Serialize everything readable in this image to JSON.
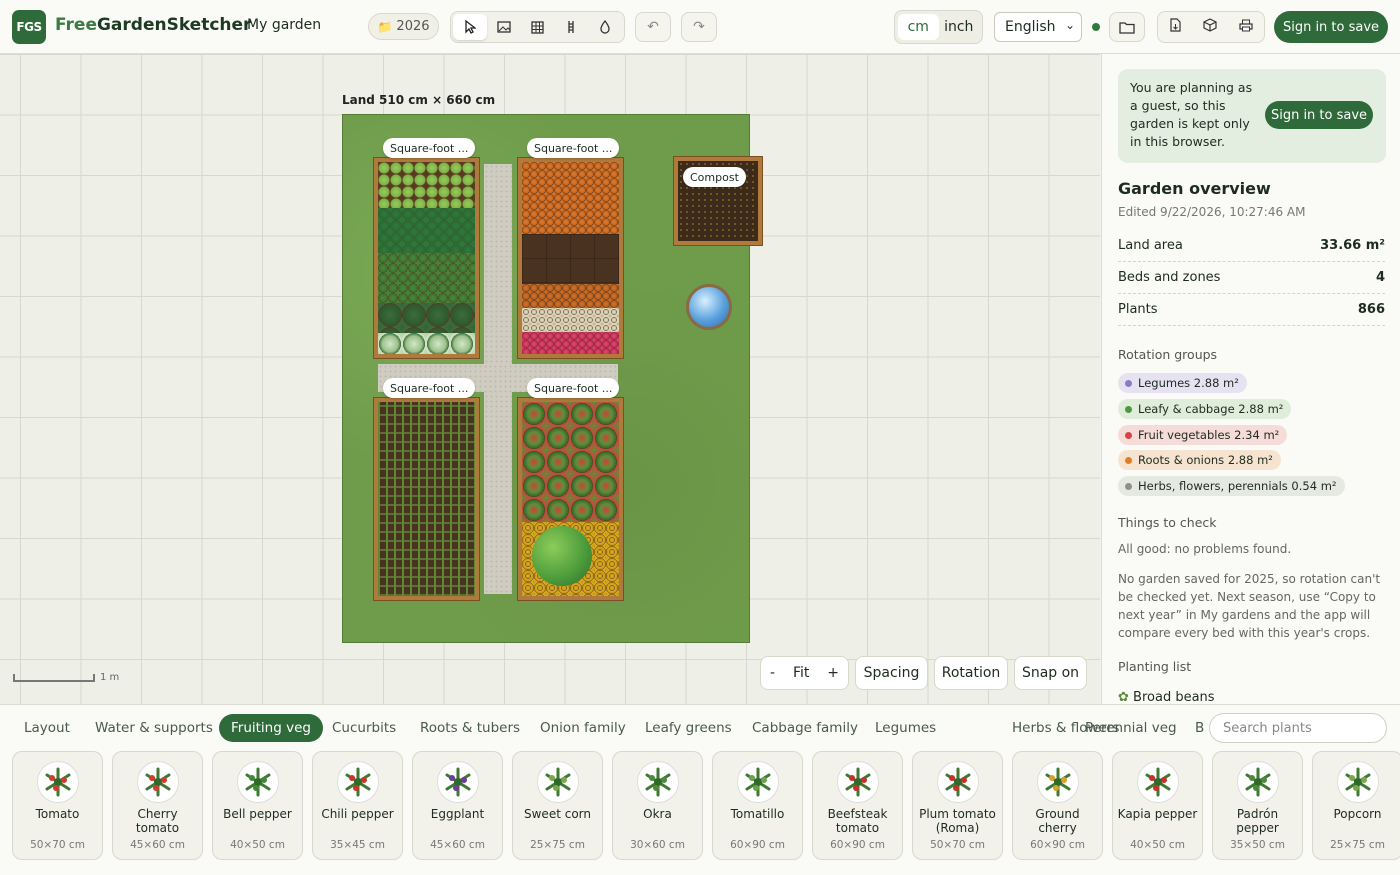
{
  "header": {
    "logo_text": "FGS",
    "brand_free": "Free",
    "brand_rest": "GardenSketcher",
    "my_garden": "My garden",
    "year": "2026",
    "unit_cm": "cm",
    "unit_inch": "inch",
    "language": "English",
    "sign_in": "Sign in to save"
  },
  "canvas": {
    "land_label": "Land 510 cm × 660 cm",
    "beds": [
      {
        "label": "Square-foot ..."
      },
      {
        "label": "Square-foot ..."
      },
      {
        "label": "Square-foot ..."
      },
      {
        "label": "Square-foot ..."
      }
    ],
    "compost_label": "Compost",
    "scale_label": "1 m",
    "zoom_minus": "-",
    "zoom_fit": "Fit",
    "zoom_plus": "+",
    "spacing": "Spacing",
    "rotation": "Rotation",
    "snap": "Snap on"
  },
  "sidebar": {
    "guest_text": "You are planning as a guest, so this garden is kept only in this browser.",
    "guest_button": "Sign in to save",
    "title": "Garden overview",
    "edited": "Edited 9/22/2026, 10:27:46 AM",
    "stats": [
      {
        "label": "Land area",
        "value": "33.66 m²"
      },
      {
        "label": "Beds and zones",
        "value": "4"
      },
      {
        "label": "Plants",
        "value": "866"
      }
    ],
    "rotation_title": "Rotation groups",
    "rotation_groups": [
      {
        "label": "Legumes 2.88 m²",
        "color": "#8a7bc6",
        "bg": "#e6e2f2"
      },
      {
        "label": "Leafy & cabbage 2.88 m²",
        "color": "#4a9a3c",
        "bg": "#e0eddb"
      },
      {
        "label": "Fruit vegetables 2.34 m²",
        "color": "#d64545",
        "bg": "#f6dcd8"
      },
      {
        "label": "Roots & onions 2.88 m²",
        "color": "#e07d2a",
        "bg": "#f6e4d0"
      },
      {
        "label": "Herbs, flowers, perennials 0.54 m²",
        "color": "#8a908a",
        "bg": "#e6e8e2"
      }
    ],
    "check_title": "Things to check",
    "check_status": "All good: no problems found.",
    "check_note": "No garden saved for 2025, so rotation can't be checked yet. Next season, use “Copy to next year” in My gardens and the app will compare every bed with this year's crops.",
    "planting_title": "Planting list",
    "planting_first": "Broad beans"
  },
  "categories": [
    "Layout",
    "Water & supports",
    "Fruiting veg",
    "Cucurbits",
    "Roots & tubers",
    "Onion family",
    "Leafy greens",
    "Cabbage family",
    "Legumes",
    "Herbs & flowers",
    "Perennial veg",
    "B"
  ],
  "active_category": "Fruiting veg",
  "search_placeholder": "Search plants",
  "plants": [
    {
      "name": "Tomato",
      "size": "50×70 cm",
      "color": "#d23b2f"
    },
    {
      "name": "Cherry tomato",
      "size": "45×60 cm",
      "color": "#d23b2f"
    },
    {
      "name": "Bell pepper",
      "size": "40×50 cm",
      "color": "#3f8a36"
    },
    {
      "name": "Chili pepper",
      "size": "35×45 cm",
      "color": "#c8362a"
    },
    {
      "name": "Eggplant",
      "size": "45×60 cm",
      "color": "#6b3c9a"
    },
    {
      "name": "Sweet corn",
      "size": "25×75 cm",
      "color": "#7aa84a"
    },
    {
      "name": "Okra",
      "size": "30×60 cm",
      "color": "#4f8a3a"
    },
    {
      "name": "Tomatillo",
      "size": "60×90 cm",
      "color": "#6aa34a"
    },
    {
      "name": "Beefsteak tomato",
      "size": "60×90 cm",
      "color": "#c8302a"
    },
    {
      "name": "Plum tomato (Roma)",
      "size": "50×70 cm",
      "color": "#c8302a"
    },
    {
      "name": "Ground cherry",
      "size": "60×90 cm",
      "color": "#d8a02a"
    },
    {
      "name": "Kapia pepper",
      "size": "40×50 cm",
      "color": "#c8302a"
    },
    {
      "name": "Padrón pepper",
      "size": "35×50 cm",
      "color": "#4f8a3a"
    },
    {
      "name": "Popcorn",
      "size": "25×75 cm",
      "color": "#7aa84a"
    }
  ]
}
